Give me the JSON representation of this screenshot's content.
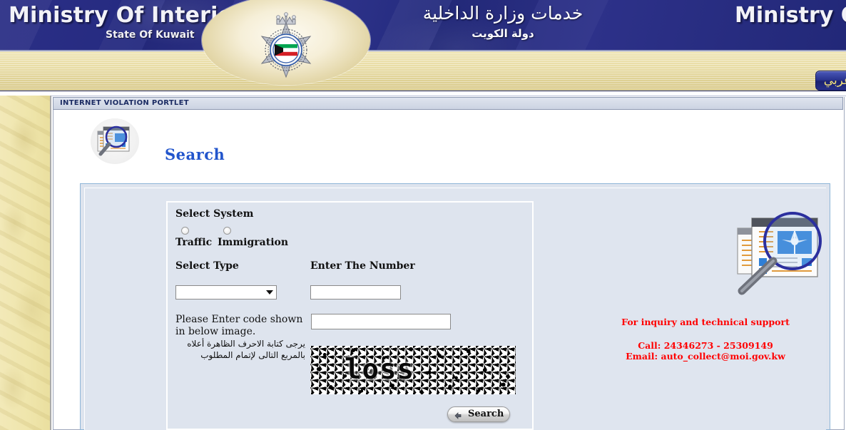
{
  "header": {
    "title_en": "Ministry Of Interior",
    "subtitle_en": "State Of Kuwait",
    "title_ar": "خدمات وزارة الداخلية",
    "subtitle_ar": "دولة الكويت",
    "title_en_right": "Ministry Of",
    "lang_toggle": "عربي",
    "emblem_icon": "moi-kuwait-emblem"
  },
  "portlet": {
    "title": "INTERNET VIOLATION PORTLET",
    "heading": "Search",
    "heading_icon": "magnifier-documents-icon"
  },
  "form": {
    "select_system_label": "Select System",
    "system_options": [
      {
        "label": "Traffic",
        "selected": false
      },
      {
        "label": "Immigration",
        "selected": false
      }
    ],
    "select_type_label": "Select Type",
    "select_type_value": "",
    "select_type_placeholder": "",
    "enter_number_label": "Enter The Number",
    "enter_number_value": "",
    "captcha_instruction_en": "Please Enter code shown in below image.",
    "captcha_instruction_ar": "يرجى كتابة الاحرف الظاهرة أعلاه بالمربع التالى لإتمام المطلوب",
    "captcha_input_value": "",
    "captcha_code": "loss",
    "search_button_label": "Search",
    "search_button_icon": "arrow-left-icon"
  },
  "support": {
    "heading": "For inquiry and technical support",
    "phone": "Call: 24346273 - 25309149",
    "email": "Email: auto_collect@moi.gov.kw",
    "side_icon": "magnifier-over-documents-image"
  },
  "colors": {
    "header_blue": "#252a80",
    "gold_band": "#e8dca4",
    "panel_bg": "#dee4ee",
    "heading_blue": "#2255cc",
    "support_red": "#ff0000",
    "sidebar_cream": "#efe5ab"
  }
}
